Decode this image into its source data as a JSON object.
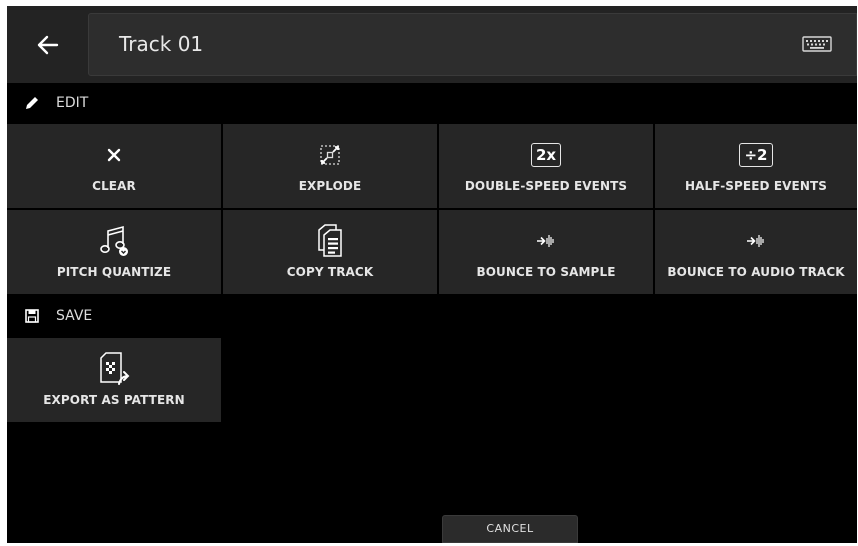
{
  "header": {
    "title": "Track 01",
    "back_icon": "arrow-left-icon",
    "keyboard_icon": "keyboard-icon"
  },
  "sections": {
    "edit": {
      "label": "EDIT",
      "icon": "pencil-icon"
    },
    "save": {
      "label": "SAVE",
      "icon": "floppy-disk-icon"
    }
  },
  "edit_tiles": [
    {
      "label": "CLEAR",
      "icon": "x-icon"
    },
    {
      "label": "EXPLODE",
      "icon": "explode-icon"
    },
    {
      "label": "DOUBLE-SPEED EVENTS",
      "icon": "double-speed-icon",
      "icon_text": "2x"
    },
    {
      "label": "HALF-SPEED EVENTS",
      "icon": "half-speed-icon",
      "icon_text": "÷2"
    },
    {
      "label": "PITCH QUANTIZE",
      "icon": "music-note-icon"
    },
    {
      "label": "COPY TRACK",
      "icon": "copy-document-icon"
    },
    {
      "label": "BOUNCE TO SAMPLE",
      "icon": "bounce-icon"
    },
    {
      "label": "BOUNCE TO AUDIO TRACK",
      "icon": "bounce-icon"
    }
  ],
  "save_tiles": [
    {
      "label": "EXPORT AS PATTERN",
      "icon": "export-pattern-icon"
    }
  ],
  "footer": {
    "cancel_label": "CANCEL"
  },
  "colors": {
    "background": "#000000",
    "header": "#232323",
    "tile": "#262626",
    "text": "#e6e6e6"
  }
}
